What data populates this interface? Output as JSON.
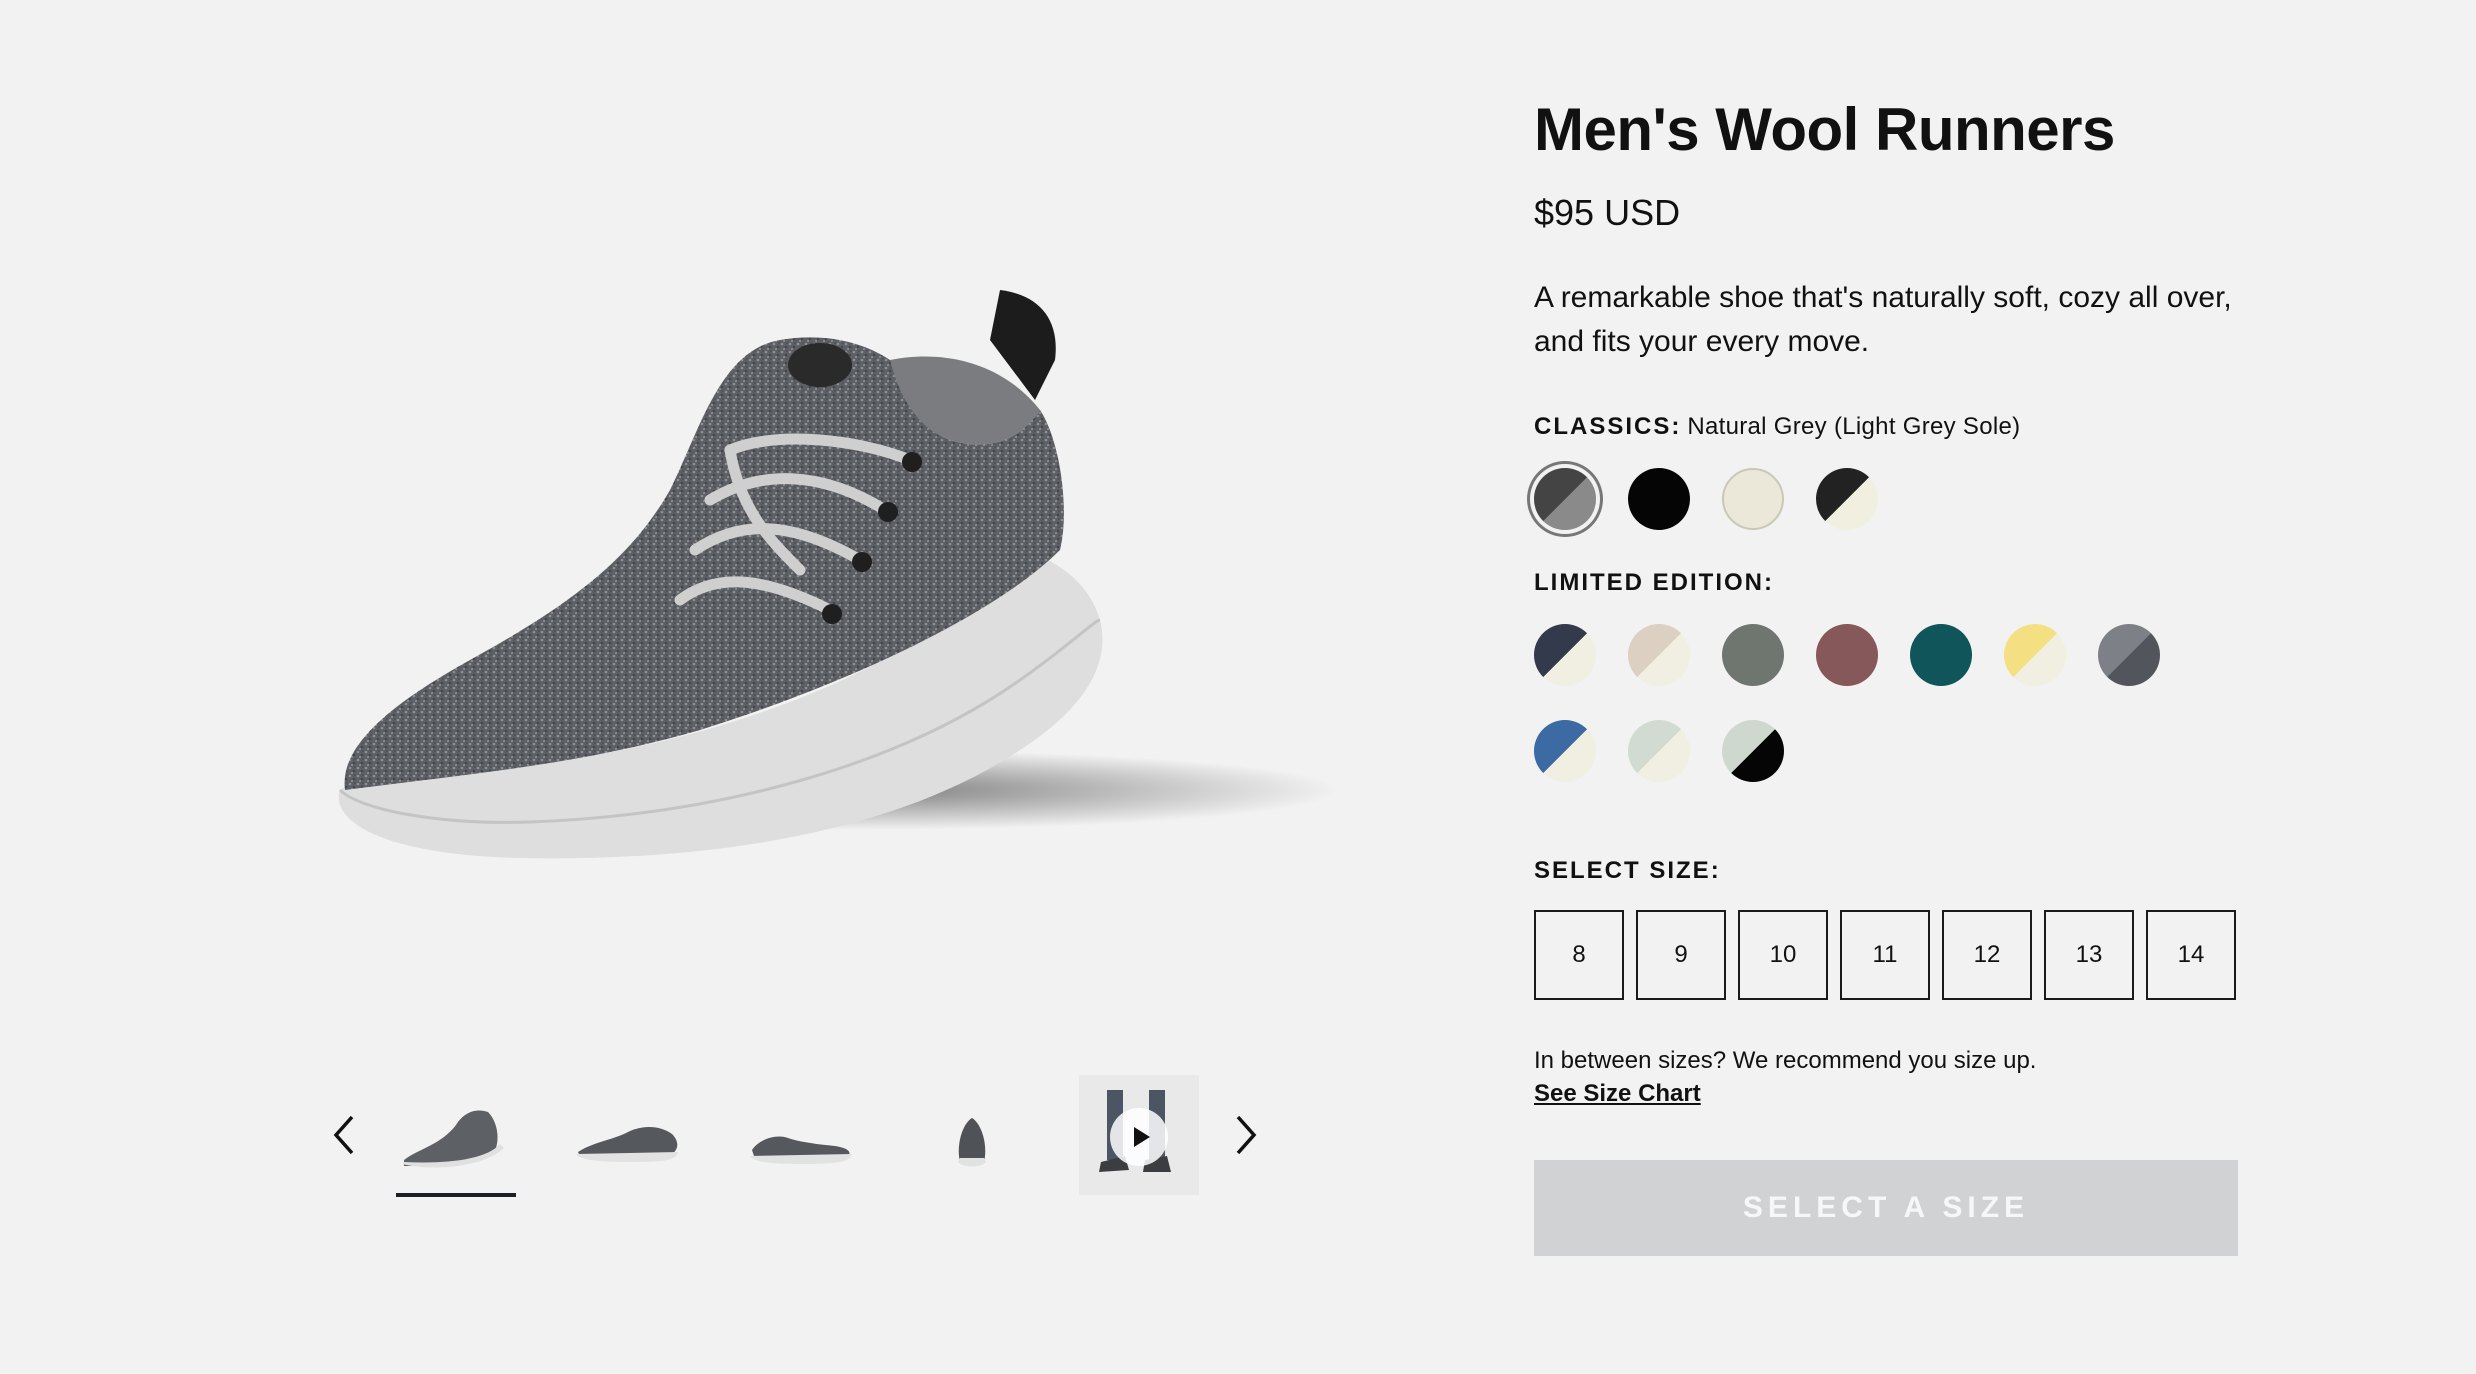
{
  "product": {
    "title": "Men's Wool Runners",
    "price": "$95 USD",
    "description": "A remarkable shoe that's naturally soft, cozy all over, and fits your every move."
  },
  "gallery": {
    "hero_image": "grey-wool-runner-sneaker",
    "thumbnails": [
      {
        "name": "three-quarter-view",
        "active": true
      },
      {
        "name": "side-view",
        "active": false
      },
      {
        "name": "other-side-view",
        "active": false
      },
      {
        "name": "back-view",
        "active": false
      },
      {
        "name": "on-foot-video",
        "active": false
      }
    ],
    "prev_icon": "chevron-left-icon",
    "next_icon": "chevron-right-icon"
  },
  "colors": {
    "classics_label": "CLASSICS:",
    "selected_color": "Natural Grey (Light Grey Sole)",
    "classics": [
      {
        "top": "#444444",
        "bottom": "#8a8a8a",
        "selected": true
      },
      {
        "top": "#050505",
        "bottom": "#050505",
        "selected": false
      },
      {
        "top": "#ebe8da",
        "bottom": "#ebe8da",
        "selected": false
      },
      {
        "top": "#222222",
        "bottom": "#f1efe0",
        "selected": false
      }
    ],
    "limited_label": "LIMITED EDITION:",
    "limited": [
      {
        "top": "#333a4c",
        "bottom": "#f1efe2"
      },
      {
        "top": "#dcd0c3",
        "bottom": "#f1efe2"
      },
      {
        "top": "#6f756f",
        "bottom": "#6f756f"
      },
      {
        "top": "#86585a",
        "bottom": "#86585a"
      },
      {
        "top": "#10555a",
        "bottom": "#10555a"
      },
      {
        "top": "#f4df82",
        "bottom": "#f1efe2"
      },
      {
        "top": "#7e8088",
        "bottom": "#52555c"
      },
      {
        "top": "#3c6aa3",
        "bottom": "#f1efe2"
      },
      {
        "top": "#d2dbd2",
        "bottom": "#f1efe2"
      },
      {
        "top": "#cfd8cf",
        "bottom": "#050505"
      }
    ]
  },
  "size": {
    "label": "SELECT SIZE:",
    "options": [
      "8",
      "9",
      "10",
      "11",
      "12",
      "13",
      "14"
    ],
    "hint": "In between sizes? We recommend you size up.",
    "chart_link": "See Size Chart"
  },
  "cta": {
    "label": "SELECT A SIZE",
    "color": "#d1d2d3"
  }
}
